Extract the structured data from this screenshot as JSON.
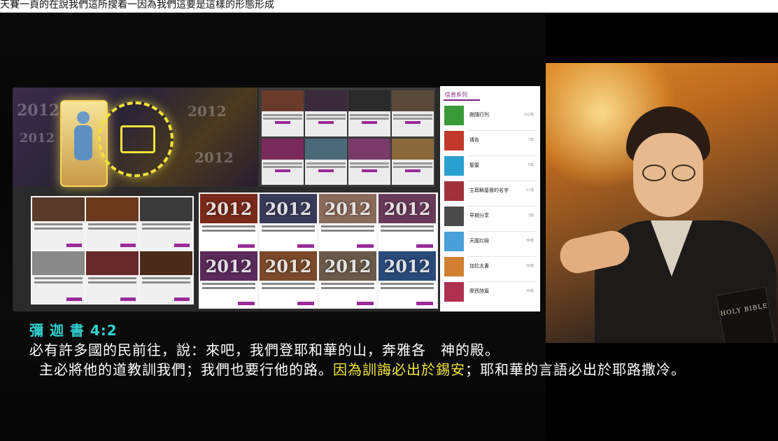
{
  "caption": {
    "top_text": "天賽一頁的在說我們這所搜着一因為我們這要是這樣的形態形成"
  },
  "screenshot": {
    "series_panel": {
      "title": "信息系列",
      "items": [
        {
          "name": "跟隨行列",
          "count": "162篇",
          "color": "#3a9a3a"
        },
        {
          "name": "禱告",
          "count": "7篇",
          "color": "#c0392b"
        },
        {
          "name": "聖靈",
          "count": "5篇",
          "color": "#2aa0d0"
        },
        {
          "name": "主耶穌基督的名字",
          "count": "11篇",
          "color": "#a0303a"
        },
        {
          "name": "早期分享",
          "count": "3篇",
          "color": "#4a4a4a"
        },
        {
          "name": "天國比喻",
          "count": "36篇",
          "color": "#4aa0d8"
        },
        {
          "name": "加拉太書",
          "count": "39篇",
          "color": "#d08030"
        },
        {
          "name": "摩西詩篇",
          "count": "39篇",
          "color": "#b03050"
        }
      ]
    },
    "grid_thumbs": [
      "2012",
      "2012",
      "2012",
      "2012",
      "2012",
      "2012",
      "2012",
      "2012"
    ]
  },
  "painting": {
    "book_label": "HOLY BIBLE"
  },
  "subtitle": {
    "reference": "彌 迦 書 4:2",
    "line1": "必有許多國的民前往，說：來吧，我們登耶和華的山，奔雅各　神的殿。",
    "line2_before": "主必將他的道教訓我們；我們也要行他的路。",
    "line2_highlight": "因為訓誨必出於錫安",
    "line2_after": "；耶和華的言語必出於耶路撒冷。"
  },
  "colors": {
    "reference": "#31d0d0",
    "highlight": "#f4e63a",
    "accent_purple": "#9b2a9b"
  }
}
